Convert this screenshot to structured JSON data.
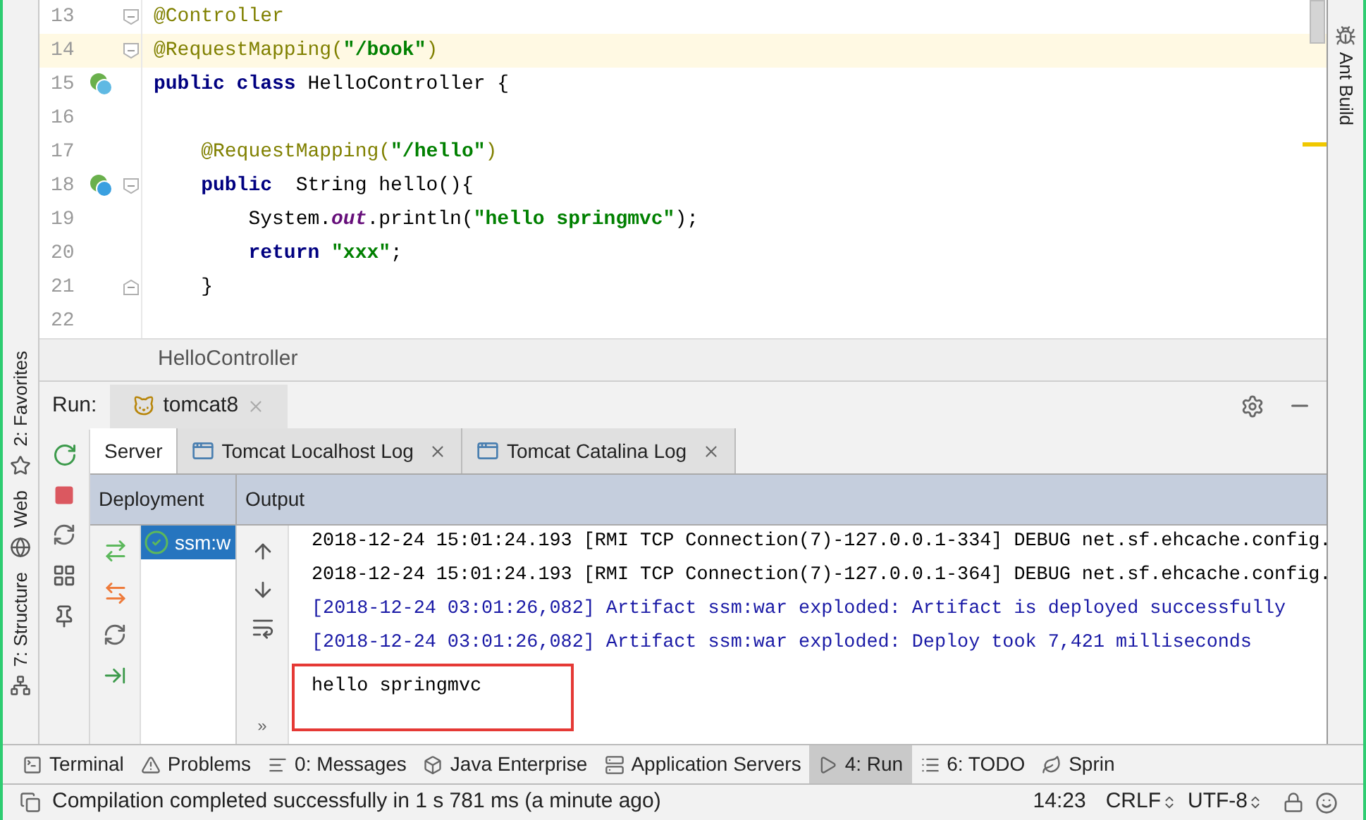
{
  "left_stripe": [
    {
      "kind": "favorites",
      "label": "2: Favorites"
    },
    {
      "kind": "web",
      "label": "Web"
    },
    {
      "kind": "structure",
      "label": "7: Structure"
    }
  ],
  "right_stripe": [
    {
      "kind": "ant",
      "label": "Ant Build"
    }
  ],
  "editor": {
    "lines": [
      {
        "number": "13",
        "current": false,
        "bean_icon": false,
        "fold_start": true,
        "fold_end": false,
        "tokens": [
          {
            "kind": "annotation",
            "text": "@Controller"
          }
        ]
      },
      {
        "number": "14",
        "current": true,
        "bean_icon": false,
        "fold_start": true,
        "fold_end": false,
        "tokens": [
          {
            "kind": "annotation",
            "text": "@RequestMapping("
          },
          {
            "kind": "string",
            "text": "\"/book\""
          },
          {
            "kind": "annotation",
            "text": ")"
          }
        ]
      },
      {
        "number": "15",
        "current": false,
        "bean_icon": true,
        "fold_start": false,
        "fold_end": false,
        "tokens": [
          {
            "kind": "keyword",
            "text": "public class"
          },
          {
            "kind": "plain",
            "text": " HelloController {"
          }
        ]
      },
      {
        "number": "16",
        "current": false,
        "bean_icon": false,
        "fold_start": false,
        "fold_end": false
      },
      {
        "number": "17",
        "current": false,
        "bean_icon": false,
        "fold_start": false,
        "fold_end": false,
        "tokens": [
          {
            "kind": "annotation",
            "text": "    @RequestMapping("
          },
          {
            "kind": "string",
            "text": "\"/hello\""
          },
          {
            "kind": "annotation",
            "text": ")"
          }
        ]
      },
      {
        "number": "18",
        "current": false,
        "bean_icon": true,
        "fold_start": true,
        "fold_end": false,
        "tokens": [
          {
            "kind": "keyword",
            "text": "    public"
          },
          {
            "kind": "plain",
            "text": "  String hello(){"
          }
        ]
      },
      {
        "number": "19",
        "current": false,
        "bean_icon": false,
        "fold_start": false,
        "fold_end": false,
        "tokens": [
          {
            "kind": "plain",
            "text": "        System."
          },
          {
            "kind": "static",
            "text": "out"
          },
          {
            "kind": "plain",
            "text": ".println("
          },
          {
            "kind": "string",
            "text": "\"hello springmvc\""
          },
          {
            "kind": "plain",
            "text": ");"
          }
        ]
      },
      {
        "number": "20",
        "current": false,
        "bean_icon": false,
        "fold_start": false,
        "fold_end": false,
        "tokens": [
          {
            "kind": "keyword",
            "text": "        return "
          },
          {
            "kind": "string",
            "text": "\"xxx\""
          },
          {
            "kind": "plain",
            "text": ";"
          }
        ]
      },
      {
        "number": "21",
        "current": false,
        "bean_icon": false,
        "fold_start": false,
        "fold_end": true,
        "tokens": [
          {
            "kind": "plain",
            "text": "    }"
          }
        ]
      },
      {
        "number": "22",
        "current": false,
        "bean_icon": false,
        "fold_start": false,
        "fold_end": false
      }
    ]
  },
  "breadcrumb": "HelloController",
  "run": {
    "label": "Run:",
    "tabs": [
      {
        "label": "tomcat8",
        "selected": true
      }
    ],
    "subtabs": [
      {
        "label": "Server",
        "selected": true,
        "closable": false
      },
      {
        "label": "Tomcat Localhost Log",
        "selected": false,
        "closable": true
      },
      {
        "label": "Tomcat Catalina Log",
        "selected": false,
        "closable": true
      }
    ],
    "columns": [
      "Deployment",
      "Output"
    ],
    "deployments": [
      {
        "label": "ssm:w",
        "selected": true
      }
    ],
    "more": "»",
    "output": [
      {
        "kind": "debug",
        "text": "2018-12-24 15:01:24.193 [RMI TCP Connection(7)-127.0.0.1-334] DEBUG net.sf.ehcache.config."
      },
      {
        "kind": "debug",
        "text": "2018-12-24 15:01:24.193 [RMI TCP Connection(7)-127.0.0.1-364] DEBUG net.sf.ehcache.config."
      },
      {
        "kind": "info",
        "text": "[2018-12-24 03:01:26,082] Artifact ssm:war exploded: Artifact is deployed successfully"
      },
      {
        "kind": "info",
        "text": "[2018-12-24 03:01:26,082] Artifact ssm:war exploded: Deploy took 7,421 milliseconds"
      },
      {
        "kind": "stdout",
        "text": "hello springmvc",
        "boxed": true
      }
    ]
  },
  "bottom_tabs": [
    {
      "kind": "terminal",
      "label": "Terminal",
      "selected": false
    },
    {
      "kind": "problems",
      "label": "Problems",
      "selected": false
    },
    {
      "kind": "messages",
      "label": "0: Messages",
      "selected": false
    },
    {
      "kind": "enterprise",
      "label": "Java Enterprise",
      "selected": false
    },
    {
      "kind": "servers",
      "label": "Application Servers",
      "selected": false
    },
    {
      "kind": "run",
      "label": "4: Run",
      "selected": true
    },
    {
      "kind": "todo",
      "label": "6: TODO",
      "selected": false
    },
    {
      "kind": "spring",
      "label": "Sprin",
      "selected": false
    }
  ],
  "status_bar": {
    "message": "Compilation completed successfully in 1 s 781 ms (a minute ago)",
    "position": "14:23",
    "line_separator": "CRLF",
    "encoding": "UTF-8"
  }
}
